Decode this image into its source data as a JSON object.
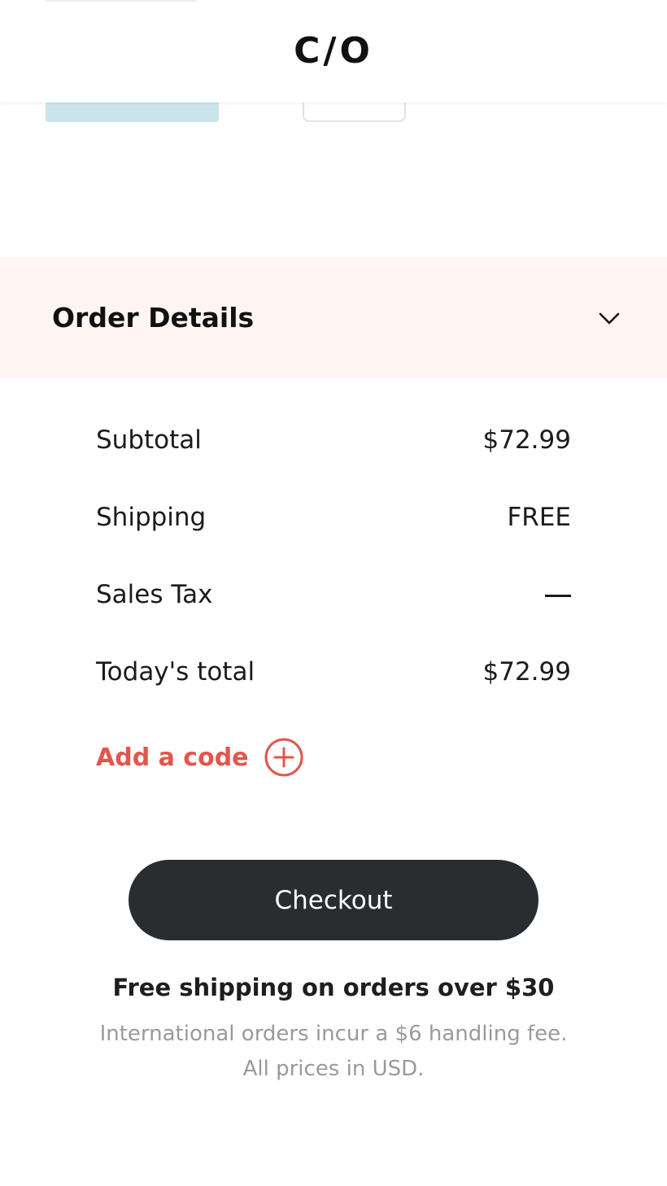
{
  "header": {
    "logo": "C/O"
  },
  "order_details": {
    "title": "Order Details",
    "toggle_icon": "chevron-down-icon"
  },
  "summary": {
    "rows": [
      {
        "label": "Subtotal",
        "value": "$72.99"
      },
      {
        "label": "Shipping",
        "value": "FREE"
      },
      {
        "label": "Sales Tax",
        "value": "—"
      },
      {
        "label": "Today's total",
        "value": "$72.99"
      }
    ]
  },
  "promo": {
    "label": "Add a code",
    "icon": "plus-circle-icon"
  },
  "checkout": {
    "label": "Checkout"
  },
  "notes": {
    "free_shipping": "Free shipping on orders over $30",
    "international": "International orders incur a $6 handling fee.",
    "currency": "All prices in USD."
  },
  "colors": {
    "accent": "#e4554b",
    "button": "#2a2d30",
    "details_bar": "#fff6f3",
    "muted_text": "#9a9a9a"
  }
}
